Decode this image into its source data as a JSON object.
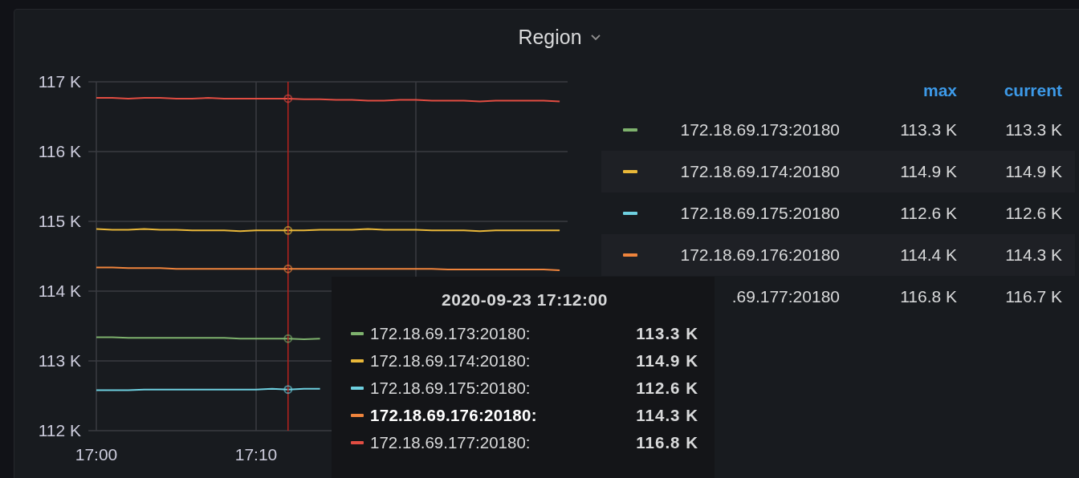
{
  "panel": {
    "title": "Region"
  },
  "chart_data": {
    "type": "line",
    "categories": [
      "17:00",
      null,
      null,
      null,
      null,
      null,
      null,
      null,
      null,
      null,
      "17:10",
      null,
      null,
      null,
      null,
      null,
      null,
      null,
      null,
      null,
      null,
      null,
      null,
      null,
      null,
      null,
      null,
      null,
      null,
      null
    ],
    "ylim": [
      112,
      117
    ],
    "yticks": [
      {
        "value": 112,
        "label": "112 K"
      },
      {
        "value": 113,
        "label": "113 K"
      },
      {
        "value": 114,
        "label": "114 K"
      },
      {
        "value": 115,
        "label": "115 K"
      },
      {
        "value": 116,
        "label": "116 K"
      },
      {
        "value": 117,
        "label": "117 K"
      }
    ],
    "series": [
      {
        "color": "#7eb26d",
        "values": [
          113.34,
          113.34,
          113.33,
          113.33,
          113.33,
          113.33,
          113.33,
          113.33,
          113.33,
          113.32,
          113.32,
          113.32,
          113.32,
          113.31,
          113.32,
          null,
          null,
          null,
          null,
          null,
          null,
          null,
          null,
          null,
          null,
          null,
          null,
          null,
          null,
          null
        ]
      },
      {
        "color": "#eab839",
        "values": [
          114.89,
          114.88,
          114.88,
          114.89,
          114.88,
          114.88,
          114.87,
          114.87,
          114.87,
          114.86,
          114.87,
          114.87,
          114.87,
          114.87,
          114.88,
          114.88,
          114.88,
          114.89,
          114.88,
          114.88,
          114.88,
          114.87,
          114.87,
          114.87,
          114.86,
          114.87,
          114.87,
          114.87,
          114.87,
          114.87
        ]
      },
      {
        "color": "#6ed0e0",
        "values": [
          112.58,
          112.58,
          112.58,
          112.59,
          112.59,
          112.59,
          112.59,
          112.59,
          112.59,
          112.59,
          112.59,
          112.6,
          112.59,
          112.6,
          112.6,
          null,
          null,
          null,
          null,
          null,
          null,
          null,
          null,
          null,
          null,
          null,
          null,
          null,
          null,
          null
        ]
      },
      {
        "color": "#ef843c",
        "values": [
          114.34,
          114.34,
          114.33,
          114.33,
          114.33,
          114.32,
          114.32,
          114.32,
          114.32,
          114.32,
          114.32,
          114.32,
          114.32,
          114.32,
          114.32,
          114.32,
          114.32,
          114.32,
          114.32,
          114.32,
          114.32,
          114.32,
          114.31,
          114.31,
          114.31,
          114.31,
          114.31,
          114.31,
          114.31,
          114.3
        ]
      },
      {
        "color": "#e24d42",
        "values": [
          116.77,
          116.77,
          116.76,
          116.77,
          116.77,
          116.76,
          116.76,
          116.77,
          116.76,
          116.76,
          116.76,
          116.76,
          116.76,
          116.75,
          116.75,
          116.74,
          116.74,
          116.73,
          116.73,
          116.74,
          116.74,
          116.73,
          116.73,
          116.73,
          116.72,
          116.73,
          116.73,
          116.73,
          116.73,
          116.72
        ]
      }
    ],
    "grid": true
  },
  "legend": {
    "columns": [
      "max",
      "current"
    ],
    "items": [
      {
        "name": "172.18.69.173:20180",
        "color": "#7eb26d",
        "max": "113.3 K",
        "current": "113.3 K"
      },
      {
        "name": "172.18.69.174:20180",
        "color": "#eab839",
        "max": "114.9 K",
        "current": "114.9 K"
      },
      {
        "name": "172.18.69.175:20180",
        "color": "#6ed0e0",
        "max": "112.6 K",
        "current": "112.6 K"
      },
      {
        "name": "172.18.69.176:20180",
        "color": "#ef843c",
        "max": "114.4 K",
        "current": "114.3 K"
      },
      {
        "name": ".69.177:20180",
        "max": "116.8 K",
        "current": "116.7 K"
      }
    ]
  },
  "tooltip": {
    "title": "2020-09-23 17:12:00",
    "items": [
      {
        "label": "172.18.69.173:20180:",
        "value": "113.3 K",
        "color": "#7eb26d",
        "selected": false
      },
      {
        "label": "172.18.69.174:20180:",
        "value": "114.9 K",
        "color": "#eab839",
        "selected": false
      },
      {
        "label": "172.18.69.175:20180:",
        "value": "112.6 K",
        "color": "#6ed0e0",
        "selected": false
      },
      {
        "label": "172.18.69.176:20180:",
        "value": "114.3 K",
        "color": "#ef843c",
        "selected": true
      },
      {
        "label": "172.18.69.177:20180:",
        "value": "116.8 K",
        "color": "#e24d42",
        "selected": false
      }
    ]
  }
}
